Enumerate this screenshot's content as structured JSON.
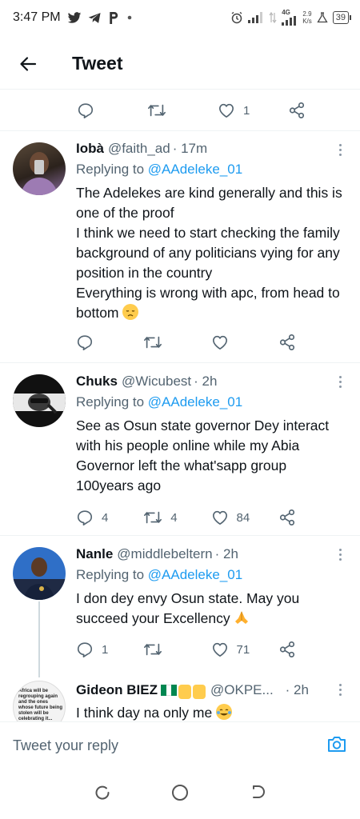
{
  "status_bar": {
    "time": "3:47 PM",
    "network_type": "4G",
    "net_speed_value": "2.9",
    "net_speed_unit": "K/s",
    "battery": "39"
  },
  "header": {
    "title": "Tweet"
  },
  "top_actions": {
    "like_count": "1"
  },
  "tweets": [
    {
      "name": "Iobà",
      "handle": "@faith_ad",
      "time": "· 17m",
      "replying_prefix": "Replying to",
      "replying_to": "@AAdeleke_01",
      "text": "The Adelekes are kind generally and this is one of the proof\nI think we need to start checking the family background of any politicians vying for any position in the country\nEverything is wrong with apc, from head to bottom",
      "emoji": "disappointed-face",
      "reply_count": "",
      "retweet_count": "",
      "like_count": ""
    },
    {
      "name": "Chuks",
      "handle": "@Wicubest",
      "time": "· 2h",
      "replying_prefix": "Replying to",
      "replying_to": "@AAdeleke_01",
      "text": "See as Osun state governor Dey interact with his people online while my Abia Governor left the what'sapp group 100years ago",
      "reply_count": "4",
      "retweet_count": "4",
      "like_count": "84"
    },
    {
      "name": "Nanle",
      "handle": "@middlebeltern",
      "time": "· 2h",
      "replying_prefix": "Replying to",
      "replying_to": "@AAdeleke_01",
      "text": "I don dey envy Osun state. May you succeed your Excellency",
      "emoji": "folded-hands",
      "reply_count": "1",
      "retweet_count": "",
      "like_count": "71"
    },
    {
      "name": "Gideon BIEZ",
      "handle": "@OKPE...",
      "time": "· 2h",
      "text": "I think day na only me",
      "emoji": "face-with-tears-of-joy",
      "avatar_text": "Africa will be regrouping again and the ones whose future being stolen will be celebrating it..."
    }
  ],
  "reply_bar": {
    "placeholder": "Tweet your reply"
  },
  "colors": {
    "accent": "#1d9bf0",
    "text_primary": "#0f1419",
    "text_secondary": "#536471",
    "divider": "#eff3f4"
  }
}
